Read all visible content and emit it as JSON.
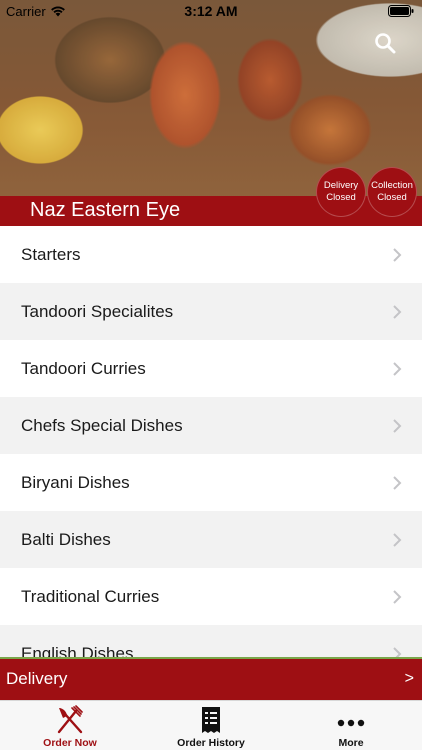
{
  "status_bar": {
    "carrier": "Carrier",
    "time": "3:12 AM"
  },
  "header": {
    "restaurant_name": "Naz Eastern Eye",
    "delivery_status": [
      "Delivery",
      "Closed"
    ],
    "collection_status": [
      "Collection",
      "Closed"
    ],
    "search_icon": "search-icon"
  },
  "menu": {
    "categories": [
      "Starters",
      "Tandoori Specialites",
      "Tandoori Curries",
      "Chefs Special Dishes",
      "Biryani Dishes",
      "Balti Dishes",
      "Traditional Curries",
      "English Dishes"
    ]
  },
  "order_mode": {
    "label": "Delivery",
    "arrow": ">"
  },
  "tabs": [
    {
      "label": "Order Now",
      "icon": "fork-knife-icon",
      "active": true
    },
    {
      "label": "Order History",
      "icon": "receipt-icon",
      "active": false
    },
    {
      "label": "More",
      "icon": "more-dots-icon",
      "active": false
    }
  ],
  "colors": {
    "brand_red": "#9e0f13",
    "accent_green": "#7aa64a"
  }
}
